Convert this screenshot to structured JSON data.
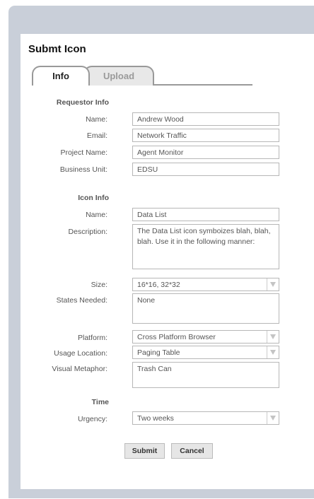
{
  "form": {
    "title": "Submt Icon"
  },
  "tabs": [
    {
      "label": "Info",
      "active": true
    },
    {
      "label": "Upload",
      "active": false
    }
  ],
  "requestor": {
    "heading": "Requestor Info",
    "name_label": "Name:",
    "name_value": "Andrew Wood",
    "email_label": "Email:",
    "email_value": "Network Traffic",
    "project_label": "Project Name:",
    "project_value": "Agent Monitor",
    "unit_label": "Business Unit:",
    "unit_value": "EDSU"
  },
  "icon_info": {
    "heading": "Icon Info",
    "name_label": "Name:",
    "name_value": "Data List",
    "description_label": "Description:",
    "description_value": "The Data List icon symboizes blah, blah, blah. Use it in the following manner:",
    "size_label": "Size:",
    "size_value": "16*16, 32*32",
    "states_label": "States Needed:",
    "states_value": "None",
    "platform_label": "Platform:",
    "platform_value": "Cross Platform Browser",
    "usage_label": "Usage Location:",
    "usage_value": "Paging Table",
    "metaphor_label": "Visual Metaphor:",
    "metaphor_value": "Trash Can"
  },
  "time": {
    "heading": "Time",
    "urgency_label": "Urgency:",
    "urgency_value": "Two weeks"
  },
  "actions": {
    "submit": "Submit",
    "cancel": "Cancel"
  },
  "icons": {
    "select_arrow": "chevron-down-icon"
  }
}
